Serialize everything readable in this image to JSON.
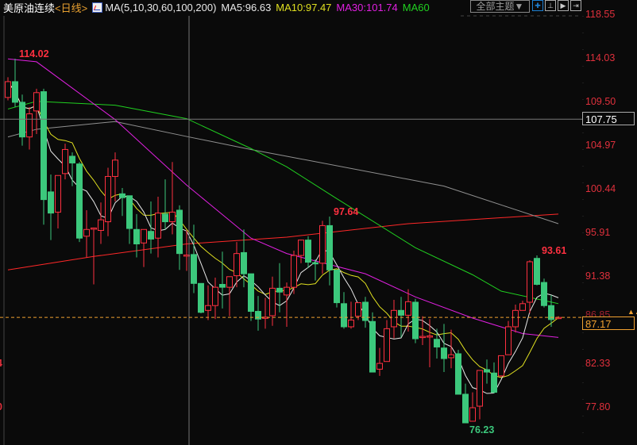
{
  "header": {
    "symbol": "美原油连续",
    "period": "<日线>",
    "ma_label": "MA(5,10,30,60,100,200)",
    "ma5": "MA5:96.63",
    "ma10": "MA10:97.47",
    "ma30": "MA30:101.74",
    "ma60": "MA60",
    "theme_button": "全部主题▼"
  },
  "toolbar": {
    "icons": [
      "crosshair-icon",
      "zoom-range-icon",
      "play-icon",
      "move-right-icon"
    ]
  },
  "colors": {
    "up": "#ff3040",
    "down": "#3cc87c",
    "ma5": "#e8e8e8",
    "ma10": "#e0e020",
    "ma30": "#e020e0",
    "ma60": "#20d020",
    "ma100": "#909090",
    "ma200": "#ff2828",
    "last": "#f0a030"
  },
  "chart_data": {
    "type": "candlestick",
    "ylim": [
      77.8,
      118.55
    ],
    "y_ticks": [
      "118.55",
      "114.03",
      "109.50",
      "104.97",
      "100.44",
      "95.91",
      "91.38",
      "86.85",
      "82.33",
      "77.80"
    ],
    "last_price": "87.17",
    "crosshair_price": "107.75",
    "crosshair_index": 25,
    "annotations": {
      "high": "114.02",
      "mid_high": "97.64",
      "low": "76.23",
      "recent_high": "93.61"
    },
    "left_axis_fragments": [
      "4",
      "0"
    ],
    "candles": [
      [
        110.0,
        112.1,
        109.7,
        111.64
      ],
      [
        111.64,
        114.02,
        109.0,
        109.5
      ],
      [
        109.5,
        110.3,
        105.0,
        105.9
      ],
      [
        105.9,
        109.0,
        104.6,
        108.3
      ],
      [
        108.6,
        110.9,
        106.2,
        110.5
      ],
      [
        110.6,
        110.9,
        96.8,
        99.4
      ],
      [
        100.2,
        102.0,
        95.2,
        98.0
      ],
      [
        98.1,
        101.9,
        96.4,
        101.9
      ],
      [
        102.1,
        105.2,
        101.5,
        104.6
      ],
      [
        103.9,
        104.3,
        100.8,
        103.2
      ],
      [
        103.1,
        103.3,
        95.0,
        95.4
      ],
      [
        95.6,
        98.3,
        93.4,
        96.3
      ],
      [
        96.35,
        96.5,
        90.6,
        96.45
      ],
      [
        96.2,
        99.1,
        94.8,
        97.3
      ],
      [
        97.1,
        102.7,
        95.6,
        101.8
      ],
      [
        101.8,
        104.3,
        99.2,
        103.5
      ],
      [
        100.0,
        100.6,
        97.7,
        99.6
      ],
      [
        99.8,
        99.8,
        94.8,
        96.4
      ],
      [
        96.3,
        97.9,
        93.4,
        94.8
      ],
      [
        94.9,
        96.3,
        92.4,
        96.3
      ],
      [
        96.1,
        99.2,
        93.8,
        95.3
      ],
      [
        95.4,
        99.7,
        93.4,
        98.0
      ],
      [
        97.9,
        101.5,
        96.3,
        97.1
      ],
      [
        97.1,
        103.3,
        95.8,
        98.1
      ],
      [
        98.3,
        98.8,
        92.1,
        93.8
      ],
      [
        93.55,
        96.2,
        92.0,
        93.65
      ],
      [
        93.7,
        96.8,
        89.7,
        90.7
      ],
      [
        90.7,
        90.7,
        87.6,
        87.7
      ],
      [
        87.9,
        90.5,
        86.9,
        88.4
      ],
      [
        88.4,
        91.3,
        87.0,
        90.3
      ],
      [
        90.6,
        94.0,
        88.1,
        90.3
      ],
      [
        90.3,
        91.4,
        87.3,
        91.4
      ],
      [
        91.5,
        95.0,
        90.3,
        93.8
      ],
      [
        93.9,
        96.3,
        90.3,
        91.7
      ],
      [
        91.7,
        91.7,
        86.8,
        87.8
      ],
      [
        87.8,
        89.4,
        85.8,
        87.0
      ],
      [
        87.1,
        89.2,
        86.0,
        87.2
      ],
      [
        87.35,
        91.4,
        86.3,
        90.2
      ],
      [
        90.2,
        92.8,
        87.7,
        89.8
      ],
      [
        89.5,
        90.8,
        86.2,
        90.3
      ],
      [
        90.3,
        94.1,
        89.6,
        93.6
      ],
      [
        93.6,
        95.25,
        92.8,
        95.2
      ],
      [
        95.2,
        95.6,
        92.3,
        92.9
      ],
      [
        92.85,
        93.2,
        91.0,
        92.75
      ],
      [
        92.8,
        97.2,
        91.7,
        96.7
      ],
      [
        96.7,
        97.64,
        90.5,
        92.1
      ],
      [
        92.1,
        92.1,
        88.2,
        88.7
      ],
      [
        88.6,
        89.8,
        86.0,
        86.2
      ],
      [
        86.2,
        88.8,
        86.0,
        86.9
      ],
      [
        87.3,
        88.7,
        86.9,
        88.7
      ],
      [
        88.75,
        89.3,
        86.1,
        86.85
      ],
      [
        86.75,
        87.7,
        81.5,
        81.5
      ],
      [
        81.8,
        84.0,
        81.1,
        82.4
      ],
      [
        82.6,
        86.9,
        82.6,
        86.0
      ],
      [
        86.2,
        89.0,
        85.0,
        87.9
      ],
      [
        87.9,
        89.3,
        85.1,
        87.4
      ],
      [
        87.4,
        90.1,
        85.7,
        88.8
      ],
      [
        88.75,
        89.1,
        84.5,
        84.96
      ],
      [
        85.1,
        87.3,
        84.3,
        85.2
      ],
      [
        85.15,
        87.0,
        82.0,
        85.25
      ],
      [
        84.9,
        86.0,
        82.9,
        84.1
      ],
      [
        84.0,
        86.5,
        81.5,
        82.9
      ],
      [
        82.99,
        85.9,
        81.9,
        83.3
      ],
      [
        83.4,
        83.8,
        79.9,
        79.2
      ],
      [
        79.2,
        80.3,
        76.23,
        76.23
      ],
      [
        76.4,
        79.4,
        76.4,
        77.8
      ],
      [
        77.96,
        81.67,
        76.6,
        81.67
      ],
      [
        81.75,
        82.8,
        80.3,
        81.5
      ],
      [
        81.4,
        82.5,
        79.3,
        79.4
      ],
      [
        81.1,
        83.2,
        81.0,
        83.2
      ],
      [
        83.3,
        86.8,
        83.3,
        86.2
      ],
      [
        86.2,
        88.5,
        85.6,
        87.9
      ],
      [
        87.9,
        88.9,
        87.9,
        88.6
      ],
      [
        88.75,
        93.1,
        87.6,
        92.95
      ],
      [
        93.3,
        93.61,
        90.5,
        90.6
      ],
      [
        90.8,
        91.2,
        88.2,
        88.4
      ],
      [
        88.4,
        89.5,
        86.2,
        86.95
      ],
      [
        87.1,
        87.3,
        87.0,
        87.17
      ]
    ],
    "ma_series": {
      "ma30": [
        [
          0,
          114.0
        ],
        [
          4,
          113.7
        ],
        [
          15,
          107.7
        ],
        [
          25,
          100.9
        ],
        [
          34,
          95.4
        ],
        [
          39,
          93.8
        ],
        [
          50,
          91.7
        ],
        [
          57,
          89.3
        ],
        [
          65,
          87.1
        ],
        [
          72,
          85.5
        ],
        [
          77,
          85.1
        ]
      ],
      "ma60": [
        [
          0,
          108.8
        ],
        [
          4,
          109.6
        ],
        [
          15,
          109.2
        ],
        [
          25,
          107.8
        ],
        [
          34,
          104.7
        ],
        [
          39,
          102.8
        ],
        [
          46,
          99.5
        ],
        [
          57,
          94.4
        ],
        [
          65,
          91.6
        ],
        [
          69,
          89.9
        ],
        [
          77,
          88.6
        ]
      ],
      "ma100": [
        [
          0,
          105.9
        ],
        [
          4,
          106.7
        ],
        [
          15,
          107.5
        ],
        [
          25,
          105.95
        ],
        [
          34,
          104.6
        ],
        [
          39,
          103.9
        ],
        [
          61,
          100.8
        ],
        [
          70,
          98.6
        ],
        [
          77,
          96.9
        ]
      ],
      "ma200": [
        [
          0,
          92.1
        ],
        [
          12,
          93.5
        ],
        [
          25,
          94.8
        ],
        [
          39,
          95.5
        ],
        [
          56,
          96.9
        ],
        [
          77,
          97.9
        ]
      ]
    }
  }
}
